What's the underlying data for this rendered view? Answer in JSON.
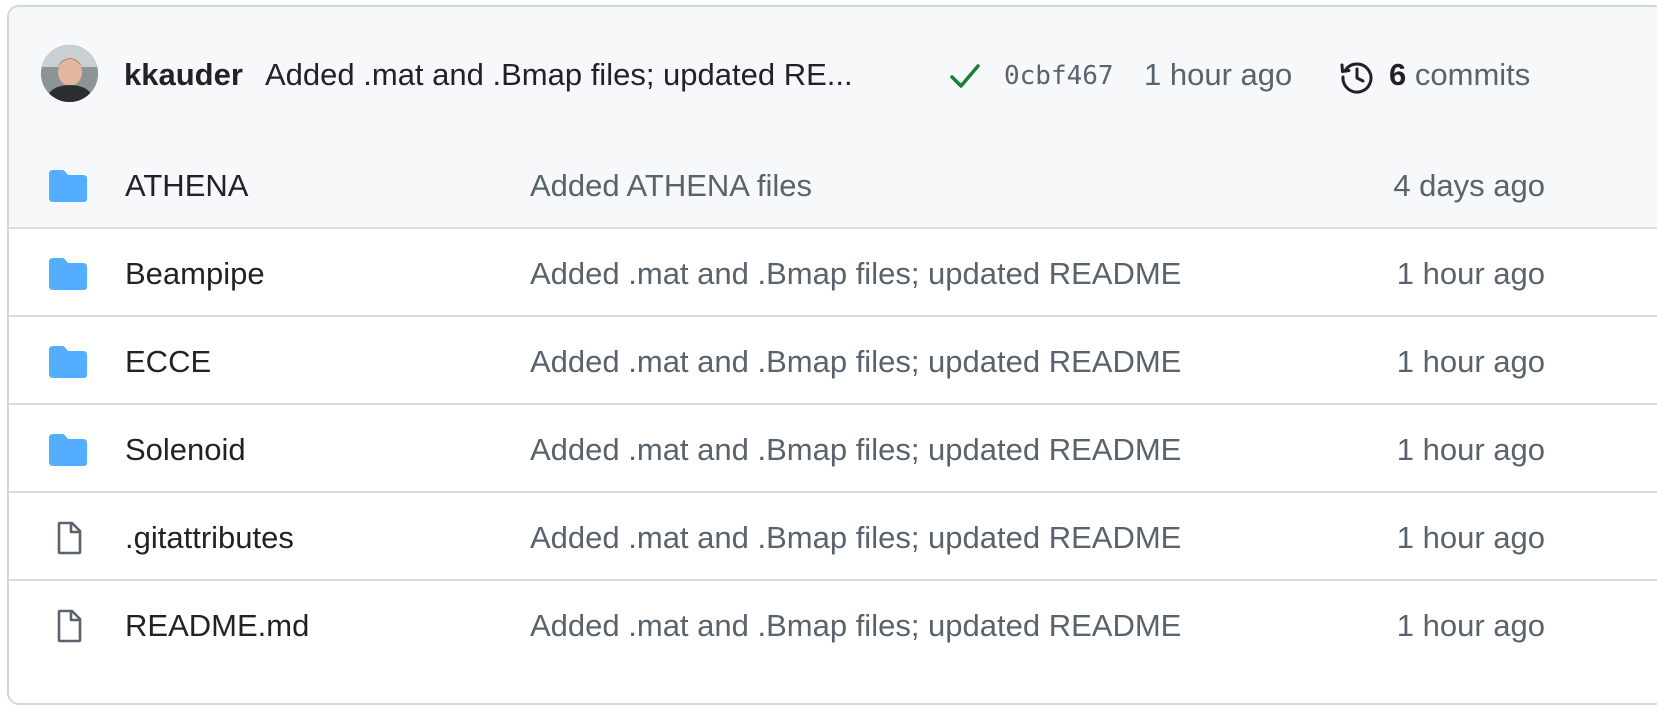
{
  "latest_commit": {
    "author": "kkauder",
    "message": "Added .mat and .Bmap files; updated RE...",
    "status_icon": "check-icon",
    "status_color": "#1a7f37",
    "sha": "0cbf467",
    "time": "1 hour ago",
    "commit_count": "6",
    "commits_label": "commits"
  },
  "files": [
    {
      "type": "folder",
      "icon": "folder-icon",
      "name": "ATHENA",
      "message": "Added ATHENA files",
      "age": "4 days ago"
    },
    {
      "type": "folder",
      "icon": "folder-icon",
      "name": "Beampipe",
      "message": "Added .mat and .Bmap files; updated README",
      "age": "1 hour ago"
    },
    {
      "type": "folder",
      "icon": "folder-icon",
      "name": "ECCE",
      "message": "Added .mat and .Bmap files; updated README",
      "age": "1 hour ago"
    },
    {
      "type": "folder",
      "icon": "folder-icon",
      "name": "Solenoid",
      "message": "Added .mat and .Bmap files; updated README",
      "age": "1 hour ago"
    },
    {
      "type": "file",
      "icon": "file-icon",
      "name": ".gitattributes",
      "message": "Added .mat and .Bmap files; updated README",
      "age": "1 hour ago"
    },
    {
      "type": "file",
      "icon": "file-icon",
      "name": "README.md",
      "message": "Added .mat and .Bmap files; updated README",
      "age": "1 hour ago"
    }
  ],
  "colors": {
    "folder": "#54aeff",
    "file": "#59636e",
    "border": "#d0d7de",
    "header_bg": "#f6f8fa"
  }
}
